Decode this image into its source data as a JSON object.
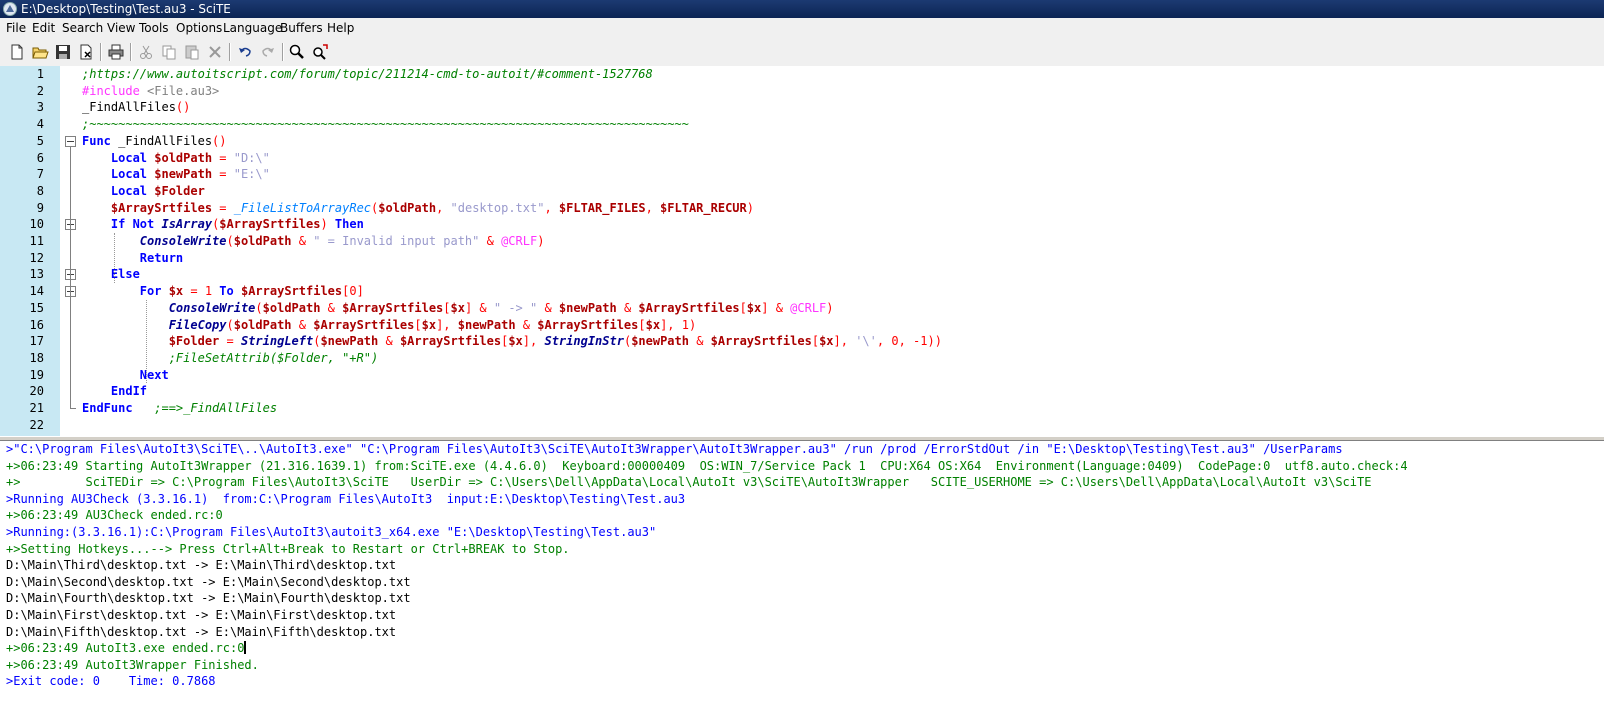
{
  "window": {
    "title": "E:\\Desktop\\Testing\\Test.au3 - SciTE"
  },
  "menu": [
    "File",
    "Edit",
    "Search",
    "View",
    "Tools",
    "Options",
    "Language",
    "Buffers",
    "Help"
  ],
  "toolbar": {
    "icons": [
      "new-icon",
      "open-icon",
      "save-icon",
      "close-icon",
      "print-icon",
      "cut-icon",
      "copy-icon",
      "paste-icon",
      "delete-icon",
      "undo-icon",
      "redo-icon",
      "find-icon",
      "replace-icon"
    ]
  },
  "editor": {
    "line_numbers": [
      "1",
      "2",
      "3",
      "4",
      "5",
      "6",
      "7",
      "8",
      "9",
      "10",
      "11",
      "12",
      "13",
      "14",
      "15",
      "16",
      "17",
      "18",
      "19",
      "20",
      "21",
      "22"
    ],
    "lines": [
      [
        {
          "t": ";https://www.autoitscript.com/forum/topic/211214-cmd-to-autoit/#comment-1527768",
          "c": "comment"
        }
      ],
      [
        {
          "t": "#include ",
          "c": "pre"
        },
        {
          "t": "<File.au3>",
          "c": "inc"
        }
      ],
      [
        {
          "t": "_FindAllFiles",
          "c": "def"
        },
        {
          "t": "()",
          "c": "op"
        }
      ],
      [
        {
          "t": ";~~~~~~~~~~~~~~~~~~~~~~~~~~~~~~~~~~~~~~~~~~~~~~~~~~~~~~~~~~~~~~~~~~~~~~~~~~~~~~~~~~~",
          "c": "comment"
        }
      ],
      [
        {
          "t": "Func ",
          "c": "kw"
        },
        {
          "t": "_FindAllFiles",
          "c": "def"
        },
        {
          "t": "()",
          "c": "op"
        }
      ],
      [
        {
          "t": "    Local ",
          "c": "kw"
        },
        {
          "t": "$oldPath",
          "c": "var"
        },
        {
          "t": " = ",
          "c": "op"
        },
        {
          "t": "\"D:\\\"",
          "c": "str"
        }
      ],
      [
        {
          "t": "    Local ",
          "c": "kw"
        },
        {
          "t": "$newPath",
          "c": "var"
        },
        {
          "t": " = ",
          "c": "op"
        },
        {
          "t": "\"E:\\\"",
          "c": "str"
        }
      ],
      [
        {
          "t": "    Local ",
          "c": "kw"
        },
        {
          "t": "$Folder",
          "c": "var"
        }
      ],
      [
        {
          "t": "    ",
          "c": "def"
        },
        {
          "t": "$ArraySrtfiles",
          "c": "var"
        },
        {
          "t": " = ",
          "c": "op"
        },
        {
          "t": "_FileListToArrayRec",
          "c": "udf"
        },
        {
          "t": "(",
          "c": "op"
        },
        {
          "t": "$oldPath",
          "c": "var"
        },
        {
          "t": ", ",
          "c": "op"
        },
        {
          "t": "\"desktop.txt\"",
          "c": "str"
        },
        {
          "t": ", ",
          "c": "op"
        },
        {
          "t": "$FLTAR_FILES",
          "c": "var"
        },
        {
          "t": ", ",
          "c": "op"
        },
        {
          "t": "$FLTAR_RECUR",
          "c": "var"
        },
        {
          "t": ")",
          "c": "op"
        }
      ],
      [
        {
          "t": "    If Not ",
          "c": "kw"
        },
        {
          "t": "IsArray",
          "c": "fn"
        },
        {
          "t": "(",
          "c": "op"
        },
        {
          "t": "$ArraySrtfiles",
          "c": "var"
        },
        {
          "t": ") ",
          "c": "op"
        },
        {
          "t": "Then",
          "c": "kw"
        }
      ],
      [
        {
          "t": "        ",
          "c": "def"
        },
        {
          "t": "ConsoleWrite",
          "c": "fn"
        },
        {
          "t": "(",
          "c": "op"
        },
        {
          "t": "$oldPath",
          "c": "var"
        },
        {
          "t": " & ",
          "c": "op"
        },
        {
          "t": "\" = Invalid input path\"",
          "c": "str"
        },
        {
          "t": " & ",
          "c": "op"
        },
        {
          "t": "@CRLF",
          "c": "macro"
        },
        {
          "t": ")",
          "c": "op"
        }
      ],
      [
        {
          "t": "        Return",
          "c": "kw"
        }
      ],
      [
        {
          "t": "    Else",
          "c": "kw"
        }
      ],
      [
        {
          "t": "        For ",
          "c": "kw"
        },
        {
          "t": "$x",
          "c": "var"
        },
        {
          "t": " = ",
          "c": "op"
        },
        {
          "t": "1",
          "c": "num"
        },
        {
          "t": " To ",
          "c": "kw"
        },
        {
          "t": "$ArraySrtfiles",
          "c": "var"
        },
        {
          "t": "[",
          "c": "op"
        },
        {
          "t": "0",
          "c": "num"
        },
        {
          "t": "]",
          "c": "op"
        }
      ],
      [
        {
          "t": "            ",
          "c": "def"
        },
        {
          "t": "ConsoleWrite",
          "c": "fn"
        },
        {
          "t": "(",
          "c": "op"
        },
        {
          "t": "$oldPath",
          "c": "var"
        },
        {
          "t": " & ",
          "c": "op"
        },
        {
          "t": "$ArraySrtfiles",
          "c": "var"
        },
        {
          "t": "[",
          "c": "op"
        },
        {
          "t": "$x",
          "c": "var"
        },
        {
          "t": "] & ",
          "c": "op"
        },
        {
          "t": "\" -> \"",
          "c": "str"
        },
        {
          "t": " & ",
          "c": "op"
        },
        {
          "t": "$newPath",
          "c": "var"
        },
        {
          "t": " & ",
          "c": "op"
        },
        {
          "t": "$ArraySrtfiles",
          "c": "var"
        },
        {
          "t": "[",
          "c": "op"
        },
        {
          "t": "$x",
          "c": "var"
        },
        {
          "t": "] & ",
          "c": "op"
        },
        {
          "t": "@CRLF",
          "c": "macro"
        },
        {
          "t": ")",
          "c": "op"
        }
      ],
      [
        {
          "t": "            ",
          "c": "def"
        },
        {
          "t": "FileCopy",
          "c": "fn"
        },
        {
          "t": "(",
          "c": "op"
        },
        {
          "t": "$oldPath",
          "c": "var"
        },
        {
          "t": " & ",
          "c": "op"
        },
        {
          "t": "$ArraySrtfiles",
          "c": "var"
        },
        {
          "t": "[",
          "c": "op"
        },
        {
          "t": "$x",
          "c": "var"
        },
        {
          "t": "], ",
          "c": "op"
        },
        {
          "t": "$newPath",
          "c": "var"
        },
        {
          "t": " & ",
          "c": "op"
        },
        {
          "t": "$ArraySrtfiles",
          "c": "var"
        },
        {
          "t": "[",
          "c": "op"
        },
        {
          "t": "$x",
          "c": "var"
        },
        {
          "t": "], ",
          "c": "op"
        },
        {
          "t": "1",
          "c": "num"
        },
        {
          "t": ")",
          "c": "op"
        }
      ],
      [
        {
          "t": "            ",
          "c": "def"
        },
        {
          "t": "$Folder",
          "c": "var"
        },
        {
          "t": " = ",
          "c": "op"
        },
        {
          "t": "StringLeft",
          "c": "fn"
        },
        {
          "t": "(",
          "c": "op"
        },
        {
          "t": "$newPath",
          "c": "var"
        },
        {
          "t": " & ",
          "c": "op"
        },
        {
          "t": "$ArraySrtfiles",
          "c": "var"
        },
        {
          "t": "[",
          "c": "op"
        },
        {
          "t": "$x",
          "c": "var"
        },
        {
          "t": "], ",
          "c": "op"
        },
        {
          "t": "StringInStr",
          "c": "fn"
        },
        {
          "t": "(",
          "c": "op"
        },
        {
          "t": "$newPath",
          "c": "var"
        },
        {
          "t": " & ",
          "c": "op"
        },
        {
          "t": "$ArraySrtfiles",
          "c": "var"
        },
        {
          "t": "[",
          "c": "op"
        },
        {
          "t": "$x",
          "c": "var"
        },
        {
          "t": "], ",
          "c": "op"
        },
        {
          "t": "'\\'",
          "c": "str"
        },
        {
          "t": ", ",
          "c": "op"
        },
        {
          "t": "0",
          "c": "num"
        },
        {
          "t": ", ",
          "c": "op"
        },
        {
          "t": "-1",
          "c": "num"
        },
        {
          "t": "))",
          "c": "op"
        }
      ],
      [
        {
          "t": "            ;FileSetAttrib($Folder, \"+R\")",
          "c": "comment"
        }
      ],
      [
        {
          "t": "        Next",
          "c": "kw"
        }
      ],
      [
        {
          "t": "    EndIf",
          "c": "kw"
        }
      ],
      [
        {
          "t": "EndFunc",
          "c": "kw"
        },
        {
          "t": "   ;==>_FindAllFiles",
          "c": "comment"
        }
      ],
      []
    ]
  },
  "output": {
    "lines": [
      {
        "text": ">\"C:\\Program Files\\AutoIt3\\SciTE\\..\\AutoIt3.exe\" \"C:\\Program Files\\AutoIt3\\SciTE\\AutoIt3Wrapper\\AutoIt3Wrapper.au3\" /run /prod /ErrorStdOut /in \"E:\\Desktop\\Testing\\Test.au3\" /UserParams",
        "color": "#0000ff"
      },
      {
        "text": "+>06:23:49 Starting AutoIt3Wrapper (21.316.1639.1) from:SciTE.exe (4.4.6.0)  Keyboard:00000409  OS:WIN_7/Service Pack 1  CPU:X64 OS:X64  Environment(Language:0409)  CodePage:0  utf8.auto.check:4",
        "color": "#008000"
      },
      {
        "text": "+>         SciTEDir => C:\\Program Files\\AutoIt3\\SciTE   UserDir => C:\\Users\\Dell\\AppData\\Local\\AutoIt v3\\SciTE\\AutoIt3Wrapper   SCITE_USERHOME => C:\\Users\\Dell\\AppData\\Local\\AutoIt v3\\SciTE",
        "color": "#008000"
      },
      {
        "text": ">Running AU3Check (3.3.16.1)  from:C:\\Program Files\\AutoIt3  input:E:\\Desktop\\Testing\\Test.au3",
        "color": "#0000ff"
      },
      {
        "text": "+>06:23:49 AU3Check ended.rc:0",
        "color": "#008000"
      },
      {
        "text": ">Running:(3.3.16.1):C:\\Program Files\\AutoIt3\\autoit3_x64.exe \"E:\\Desktop\\Testing\\Test.au3\"",
        "color": "#0000ff"
      },
      {
        "text": "+>Setting Hotkeys...--> Press Ctrl+Alt+Break to Restart or Ctrl+BREAK to Stop.",
        "color": "#008000"
      },
      {
        "text": "D:\\Main\\Third\\desktop.txt -> E:\\Main\\Third\\desktop.txt",
        "color": "#000000"
      },
      {
        "text": "D:\\Main\\Second\\desktop.txt -> E:\\Main\\Second\\desktop.txt",
        "color": "#000000"
      },
      {
        "text": "D:\\Main\\Fourth\\desktop.txt -> E:\\Main\\Fourth\\desktop.txt",
        "color": "#000000"
      },
      {
        "text": "D:\\Main\\First\\desktop.txt -> E:\\Main\\First\\desktop.txt",
        "color": "#000000"
      },
      {
        "text": "D:\\Main\\Fifth\\desktop.txt -> E:\\Main\\Fifth\\desktop.txt",
        "color": "#000000"
      },
      {
        "text": "+>06:23:49 AutoIt3.exe ended.rc:0",
        "color": "#008000"
      },
      {
        "text": "+>06:23:49 AutoIt3Wrapper Finished.",
        "color": "#008000"
      },
      {
        "text": ">Exit code: 0    Time: 0.7868",
        "color": "#0000ff"
      }
    ]
  }
}
